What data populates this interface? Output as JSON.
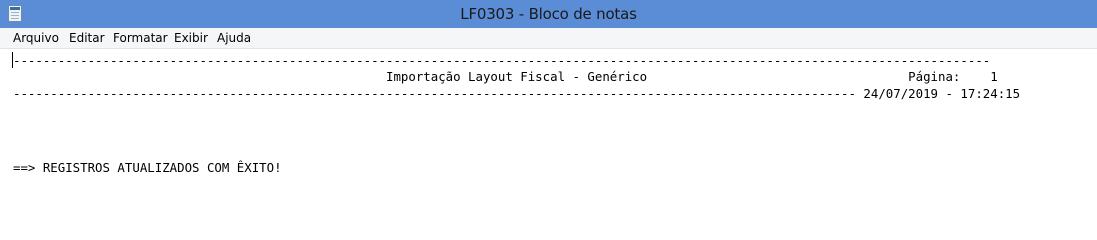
{
  "window": {
    "title": "LF0303 - Bloco de notas",
    "icon": "notepad-icon"
  },
  "menu": [
    {
      "label": "Arquivo"
    },
    {
      "label": "Editar"
    },
    {
      "label": "Formatar"
    },
    {
      "label": "Exibir"
    },
    {
      "label": "Ajuda"
    }
  ],
  "document": {
    "lines": [
      "-----------------------------------------------------------------------------------------------------------------------------------",
      "                                                  Importação Layout Fiscal - Genérico                                   Página:    1",
      "----------------------------------------------------------------------------------------------------------------- 24/07/2019 - 17:24:15",
      "==> REGISTROS ATUALIZADOS COM ÊXITO!"
    ]
  },
  "colors": {
    "titlebar": "#5b8cd6",
    "menubar": "#f5f6f7",
    "editor_background": "#ffffff"
  }
}
